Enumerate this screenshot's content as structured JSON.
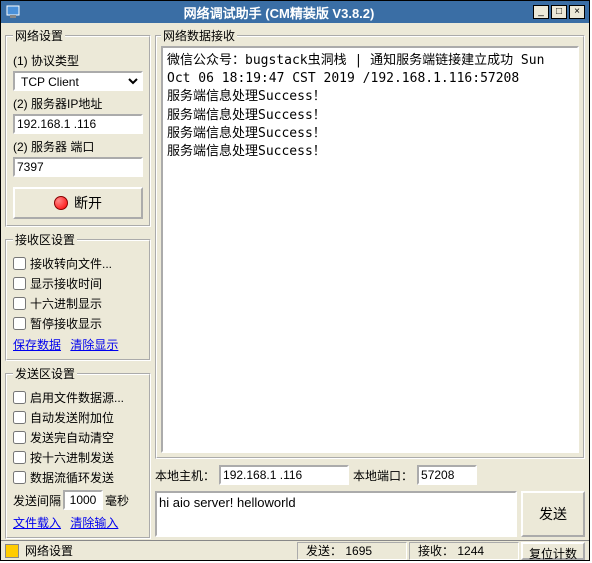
{
  "window": {
    "title": "网络调试助手 (CM精装版 V3.8.2)"
  },
  "network_settings": {
    "legend": "网络设置",
    "protocol_label": "(1) 协议类型",
    "protocol_value": "TCP Client",
    "server_ip_label": "(2) 服务器IP地址",
    "server_ip_value": "192.168.1 .116",
    "server_port_label": "(2) 服务器 端口",
    "server_port_value": "7397",
    "disconnect_label": "断开"
  },
  "recv_settings": {
    "legend": "接收区设置",
    "cb1": "接收转向文件...",
    "cb2": "显示接收时间",
    "cb3": "十六进制显示",
    "cb4": "暂停接收显示",
    "link_save": "保存数据",
    "link_clear": "清除显示"
  },
  "send_settings": {
    "legend": "发送区设置",
    "cb1": "启用文件数据源...",
    "cb2": "自动发送附加位",
    "cb3": "发送完自动清空",
    "cb4": "按十六进制发送",
    "cb5": "数据流循环发送",
    "interval_label": "发送间隔",
    "interval_value": "1000",
    "interval_unit": "毫秒",
    "link_load": "文件载入",
    "link_clear": "清除输入"
  },
  "recv_area": {
    "legend": "网络数据接收",
    "content": "微信公众号：bugstack虫洞栈 | 通知服务端链接建立成功 Sun Oct 06 18:19:47 CST 2019 /192.168.1.116:57208\n服务端信息处理Success！\n服务端信息处理Success！\n服务端信息处理Success！\n服务端信息处理Success！"
  },
  "host_info": {
    "local_host_label": "本地主机：",
    "local_host_value": "192.168.1 .116",
    "local_port_label": "本地端口：",
    "local_port_value": "57208"
  },
  "send": {
    "input_value": "hi aio server! helloworld",
    "button_label": "发送"
  },
  "status": {
    "label": "网络设置",
    "send_label": "发送：",
    "send_count": "1695",
    "recv_label": "接收：",
    "recv_count": "1244",
    "reset_label": "复位计数"
  }
}
